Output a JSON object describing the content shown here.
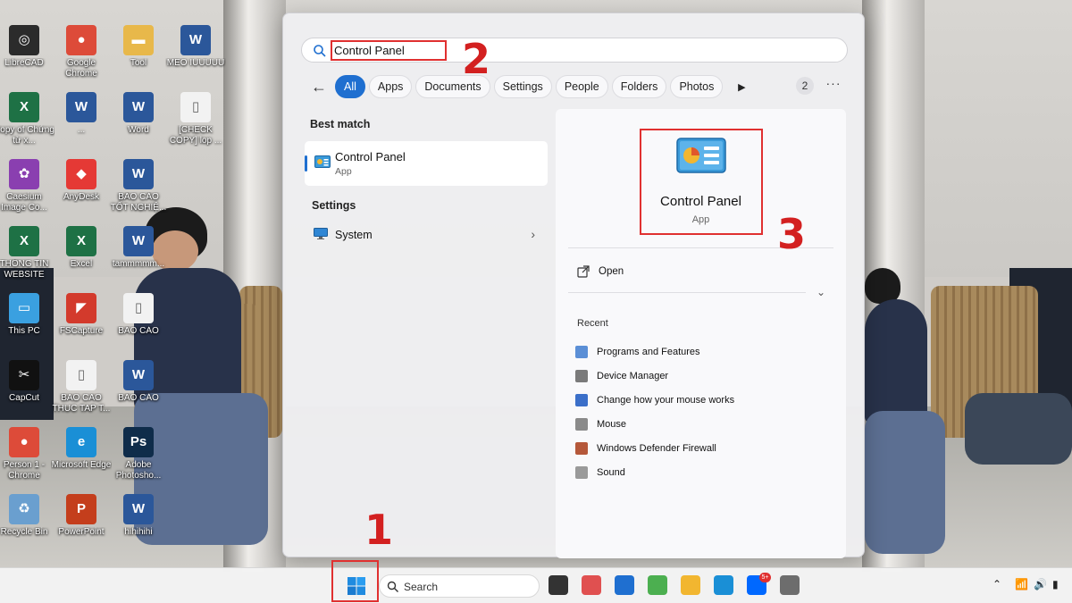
{
  "desktop": {
    "icons": [
      {
        "label": "LibreCAD",
        "color": "#2b2b2b",
        "glyph": "◎"
      },
      {
        "label": "Google Chrome",
        "color": "#dd4b39",
        "glyph": "●"
      },
      {
        "label": "Tool",
        "color": "#e8b84a",
        "glyph": "▬"
      },
      {
        "label": "MEO IUUUUU",
        "color": "#2b579a",
        "glyph": "W"
      },
      {
        "label": "Copy of Chứng từ x...",
        "color": "#1e7145",
        "glyph": "X"
      },
      {
        "label": "...",
        "color": "#2b579a",
        "glyph": "W"
      },
      {
        "label": "Word",
        "color": "#2b579a",
        "glyph": "W"
      },
      {
        "label": "[CHECK COPY] lop ...",
        "color": "#f2f2f2",
        "glyph": "▯"
      },
      {
        "label": "Caesium Image Co...",
        "color": "#8a3fb0",
        "glyph": "✿"
      },
      {
        "label": "AnyDesk",
        "color": "#e53935",
        "glyph": "◆"
      },
      {
        "label": "BÁO CÁO TỐT NGHIỆ...",
        "color": "#2b579a",
        "glyph": "W"
      },
      {
        "label": "THÔNG TIN WEBSITE",
        "color": "#1e7145",
        "glyph": "X"
      },
      {
        "label": "Excel",
        "color": "#1e7145",
        "glyph": "X"
      },
      {
        "label": "tammmmm...",
        "color": "#2b579a",
        "glyph": "W"
      },
      {
        "label": "This PC",
        "color": "#3aa0e0",
        "glyph": "▭"
      },
      {
        "label": "FSCapture",
        "color": "#d33a2c",
        "glyph": "◤"
      },
      {
        "label": "BÁO CÁO",
        "color": "#f2f2f2",
        "glyph": "▯"
      },
      {
        "label": "CapCut",
        "color": "#111111",
        "glyph": "✂"
      },
      {
        "label": "BAO CAO THUC TAP T...",
        "color": "#f2f2f2",
        "glyph": "▯"
      },
      {
        "label": "BÁO CÁO",
        "color": "#2b579a",
        "glyph": "W"
      },
      {
        "label": "Person 1 - Chrome",
        "color": "#dd4b39",
        "glyph": "●"
      },
      {
        "label": "Microsoft Edge",
        "color": "#1a8fd6",
        "glyph": "e"
      },
      {
        "label": "Adobe Photosho...",
        "color": "#0f2c4a",
        "glyph": "Ps"
      },
      {
        "label": "Recycle Bin",
        "color": "#6a9fcf",
        "glyph": "♻"
      },
      {
        "label": "PowerPoint",
        "color": "#c43e1c",
        "glyph": "P"
      },
      {
        "label": "hihihihi",
        "color": "#2b579a",
        "glyph": "W"
      }
    ]
  },
  "search_panel": {
    "query": "Control Panel",
    "filters": [
      "All",
      "Apps",
      "Documents",
      "Settings",
      "People",
      "Folders",
      "Photos"
    ],
    "active_filter": "All",
    "count": "2",
    "more": "···",
    "best_match_heading": "Best match",
    "best_match": {
      "title": "Control Panel",
      "subtitle": "App"
    },
    "settings_heading": "Settings",
    "settings_item": "System",
    "detail": {
      "title": "Control Panel",
      "subtitle": "App",
      "open_label": "Open",
      "recent_heading": "Recent",
      "recent": [
        {
          "label": "Programs and Features",
          "color": "#5b8fd6"
        },
        {
          "label": "Device Manager",
          "color": "#7a7a7a"
        },
        {
          "label": "Change how your mouse works",
          "color": "#3b6fc9"
        },
        {
          "label": "Mouse",
          "color": "#8a8a8a"
        },
        {
          "label": "Windows Defender Firewall",
          "color": "#b5583a"
        },
        {
          "label": "Sound",
          "color": "#9a9a9a"
        }
      ]
    }
  },
  "annotations": {
    "step1": "1",
    "step2": "2",
    "step3": "3"
  },
  "taskbar": {
    "search_placeholder": "Search",
    "badge": "5+",
    "apps": [
      {
        "name": "task-view-icon",
        "color": "#333333"
      },
      {
        "name": "snipping-icon",
        "color": "#e05050"
      },
      {
        "name": "store-icon",
        "color": "#1f6fd0"
      },
      {
        "name": "coccoc-icon",
        "color": "#4caf50"
      },
      {
        "name": "file-explorer-icon",
        "color": "#f2b630"
      },
      {
        "name": "edge-icon",
        "color": "#1a8fd6"
      },
      {
        "name": "zalo-icon",
        "color": "#0068ff"
      },
      {
        "name": "settings-icon",
        "color": "#6d6d6d"
      }
    ]
  },
  "colors": {
    "accent": "#1f6fd0",
    "annotation": "#e03030"
  }
}
